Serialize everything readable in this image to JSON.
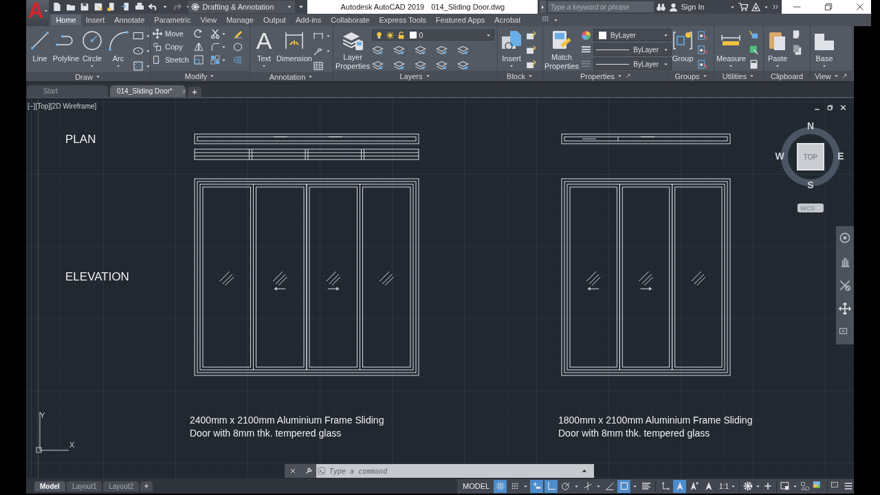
{
  "app_button": {
    "label": "A"
  },
  "workspace": {
    "label": "Drafting & Annotation"
  },
  "window": {
    "title": "Autodesk AutoCAD 2019",
    "document": "014_Sliding Door.dwg"
  },
  "search": {
    "placeholder": "Type a keyword or phrase"
  },
  "account": {
    "label": "Sign In"
  },
  "ribbon_tabs": [
    {
      "label": "Home",
      "selected": true
    },
    {
      "label": "Insert",
      "selected": false
    },
    {
      "label": "Annotate",
      "selected": false
    },
    {
      "label": "Parametric",
      "selected": false
    },
    {
      "label": "View",
      "selected": false
    },
    {
      "label": "Manage",
      "selected": false
    },
    {
      "label": "Output",
      "selected": false
    },
    {
      "label": "Add-ins",
      "selected": false
    },
    {
      "label": "Collaborate",
      "selected": false
    },
    {
      "label": "Express Tools",
      "selected": false
    },
    {
      "label": "Featured Apps",
      "selected": false
    },
    {
      "label": "Acrobat",
      "selected": false
    }
  ],
  "panels": [
    {
      "title": "Draw",
      "tools": [
        "Line",
        "Polyline",
        "Circle",
        "Arc"
      ]
    },
    {
      "title": "Modify",
      "tools": [
        "Move",
        "Copy",
        "Stretch"
      ]
    },
    {
      "title": "Annotation",
      "tools": [
        "Text",
        "Dimension"
      ],
      "glyph": "A"
    },
    {
      "title": "Layers",
      "tools": [
        "Layer\nProperties"
      ],
      "layer": "0"
    },
    {
      "title": "Block",
      "tools": [
        "Insert"
      ]
    },
    {
      "title": "Properties",
      "tools": [
        "Match\nProperties"
      ],
      "values": [
        "ByLayer",
        "ByLayer",
        "ByLayer"
      ]
    },
    {
      "title": "Groups",
      "tools": [
        "Group"
      ]
    },
    {
      "title": "Utilities",
      "tools": [
        "Measure"
      ]
    },
    {
      "title": "Clipboard",
      "tools": [
        "Paste"
      ]
    },
    {
      "title": "View",
      "tools": [
        "Base"
      ]
    }
  ],
  "file_tabs": [
    {
      "label": "Start",
      "selected": false
    },
    {
      "label": "014_Sliding Door*",
      "selected": true
    }
  ],
  "viewport": {
    "label": "[−][Top][2D Wireframe]"
  },
  "drawing": {
    "titles": [
      "PLAN",
      "ELEVATION"
    ],
    "captions": [
      "2400mm x 2100mm Aluminium Frame Sliding\nDoor with 8mm thk. tempered glass",
      "1800mm x 2100mm Aluminium Frame Sliding\nDoor with 8mm thk. tempered glass"
    ]
  },
  "viewcube": {
    "face": "TOP",
    "north": "N",
    "east": "E",
    "south": "S",
    "west": "W",
    "ucs": "WCS"
  },
  "ucs_axes": {
    "x": "X",
    "y": "Y"
  },
  "command_line": {
    "placeholder": "Type a command"
  },
  "layout_tabs": [
    {
      "label": "Model",
      "selected": true
    },
    {
      "label": "Layout1",
      "selected": false
    },
    {
      "label": "Layout2",
      "selected": false
    }
  ],
  "status_bar": {
    "space": "MODEL",
    "scale": "1:1",
    "toggles": [
      {
        "kind": "grid",
        "on": true
      },
      {
        "kind": "snap",
        "on": false
      },
      {
        "kind": "infer",
        "on": true
      },
      {
        "kind": "ortho",
        "on": true
      },
      {
        "kind": "polar",
        "on": false
      },
      {
        "kind": "isodraft",
        "on": false
      },
      {
        "kind": "otrack",
        "on": false
      },
      {
        "kind": "osnap",
        "on": true
      },
      {
        "kind": "lineweight",
        "on": false
      },
      {
        "kind": "ucs",
        "on": false
      },
      {
        "kind": "annovis",
        "on": true
      },
      {
        "kind": "autoscale",
        "on": false
      },
      {
        "kind": "annoscale",
        "on": false
      }
    ]
  }
}
